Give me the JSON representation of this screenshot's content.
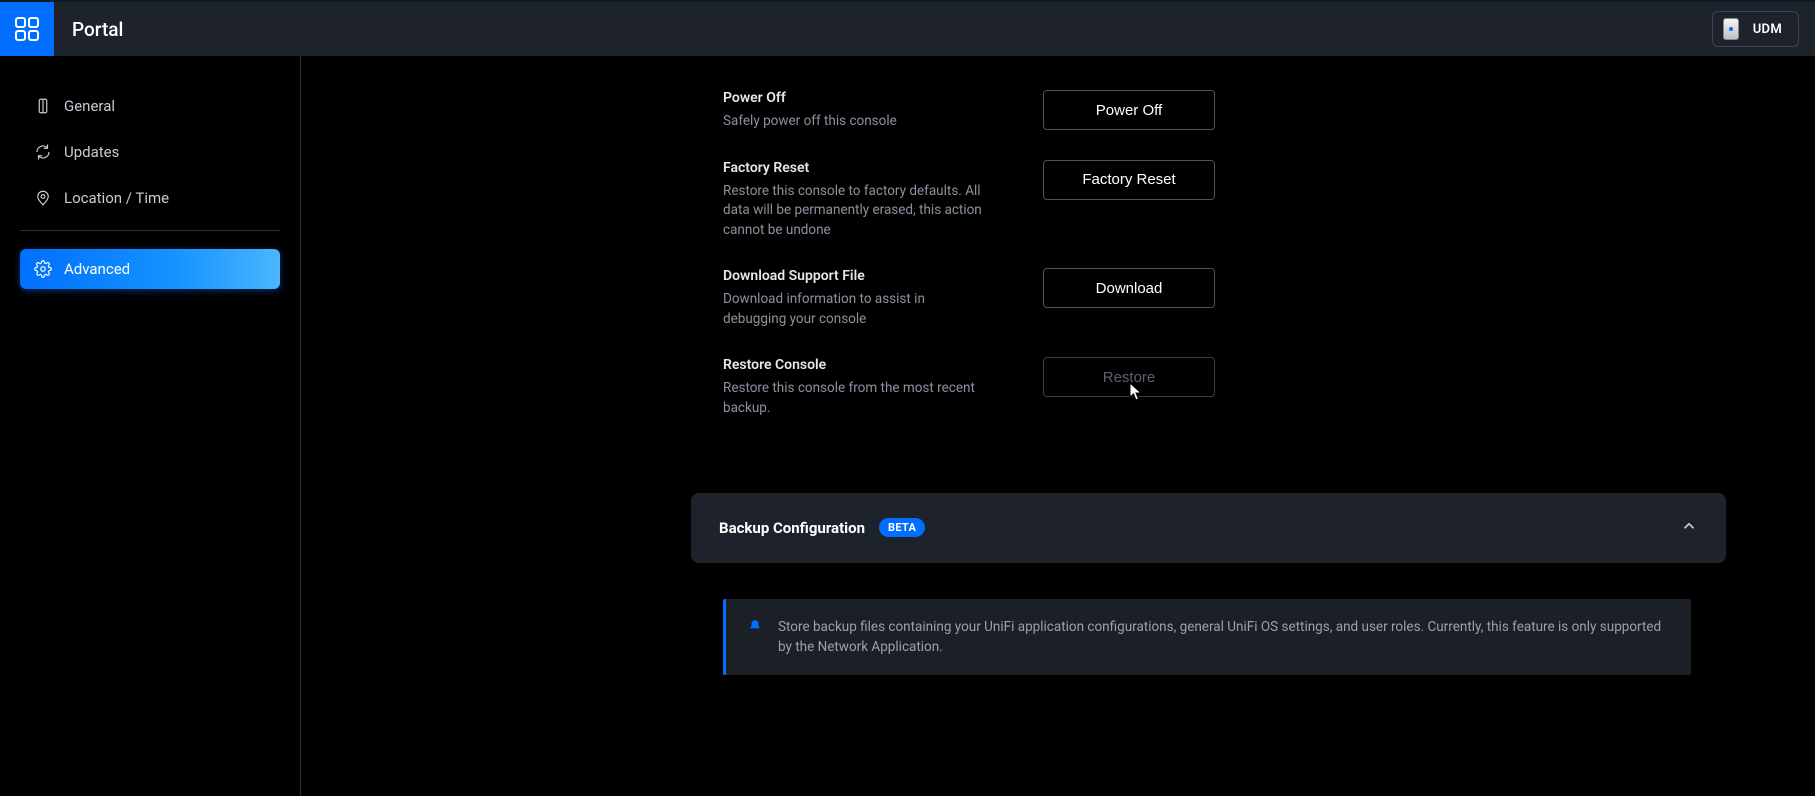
{
  "topbar": {
    "title": "Portal",
    "device_label": "UDM"
  },
  "sidebar": {
    "items": [
      {
        "label": "General"
      },
      {
        "label": "Updates"
      },
      {
        "label": "Location / Time"
      },
      {
        "label": "Advanced"
      }
    ]
  },
  "settings": {
    "power_off": {
      "title": "Power Off",
      "desc": "Safely power off this console",
      "button": "Power Off"
    },
    "factory_reset": {
      "title": "Factory Reset",
      "desc": "Restore this console to factory defaults. All data will be permanently erased, this action cannot be undone",
      "button": "Factory Reset"
    },
    "download_support": {
      "title": "Download Support File",
      "desc": "Download information to assist in debugging your console",
      "button": "Download"
    },
    "restore": {
      "title": "Restore Console",
      "desc": "Restore this console from the most recent backup.",
      "button": "Restore"
    }
  },
  "backup_section": {
    "title": "Backup Configuration",
    "badge": "BETA",
    "info": "Store backup files containing your UniFi application configurations, general UniFi OS settings, and user roles. Currently, this feature is only supported by the Network Application."
  }
}
